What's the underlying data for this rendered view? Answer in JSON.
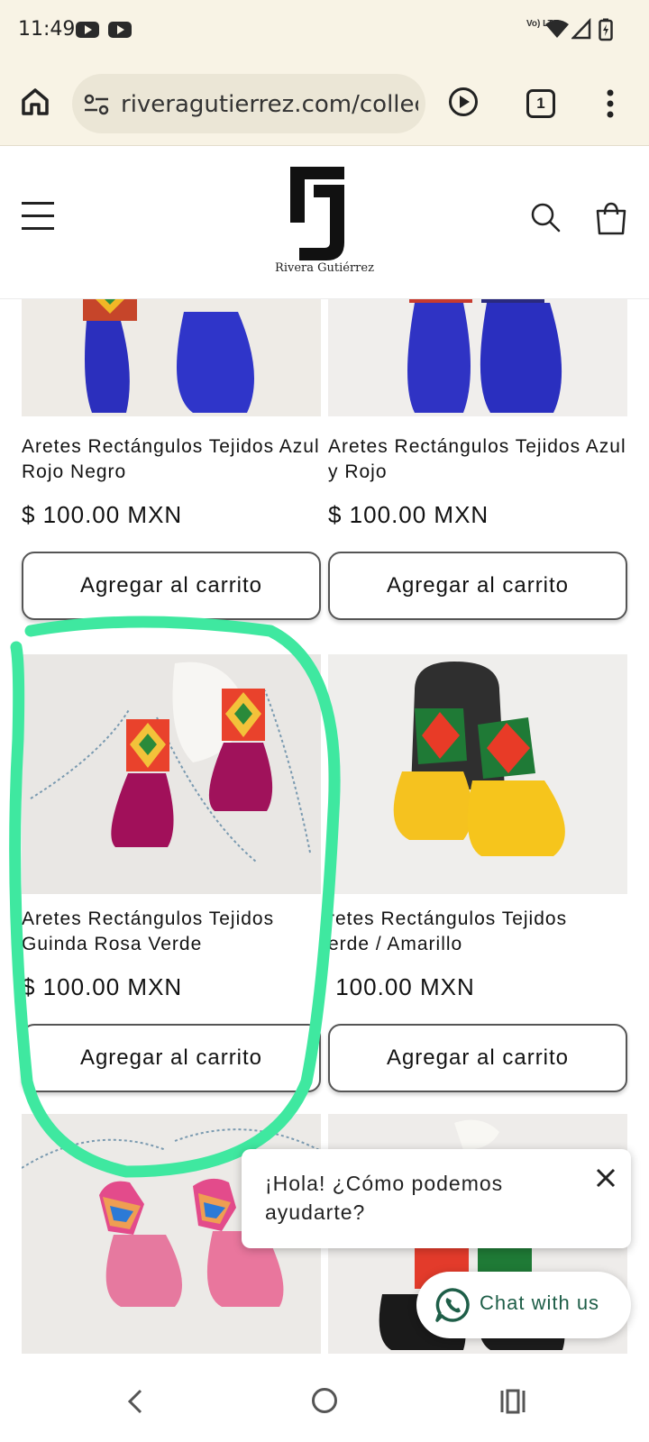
{
  "status_bar": {
    "time": "11:49",
    "network": "Vo) LTE"
  },
  "browser": {
    "url": "riveragutierrez.com/collecti",
    "tab_count": "1"
  },
  "site": {
    "brand_name": "Rivera Gutiérrez"
  },
  "products": [
    {
      "title": "Aretes Rectángulos Tejidos Azul Rojo Negro",
      "price": "$ 100.00 MXN",
      "button_label": "Agregar al carrito",
      "image": "blue-tassel-earrings"
    },
    {
      "title": "Aretes Rectángulos Tejidos Azul y Rojo",
      "price": "$ 100.00 MXN",
      "button_label": "Agregar al carrito",
      "image": "blue-red-tassel-earrings"
    },
    {
      "title": "Aretes Rectángulos Tejidos Guinda Rosa Verde",
      "price": "$ 100.00 MXN",
      "button_label": "Agregar al carrito",
      "image": "magenta-tassel-earrings"
    },
    {
      "title": "retes Rectángulos Tejidos erde / Amarillo",
      "title_line1": "retes Rectángulos Tejidos",
      "title_line2": "erde / Amarillo",
      "price": " 100.00 MXN",
      "button_label": "Agregar al carrito",
      "image": "yellow-tassel-earrings"
    },
    {
      "image": "pink-tassel-earrings"
    },
    {
      "image": "black-tassel-earrings"
    }
  ],
  "chat": {
    "greeting": "¡Hola! ¿Cómo podemos ayudarte?",
    "button_label": "Chat with us"
  },
  "colors": {
    "highlight": "#3fe8a0",
    "whatsapp": "#1e5e48",
    "browser_chrome": "#f8f3e5"
  }
}
